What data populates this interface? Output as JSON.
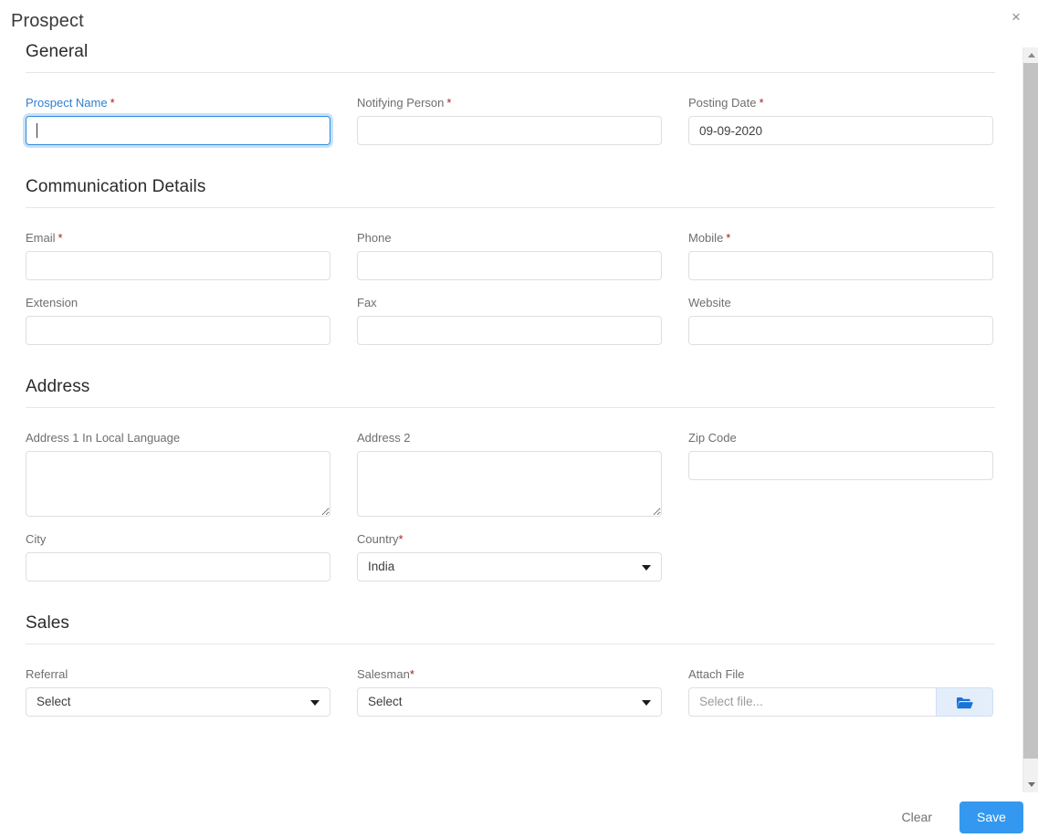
{
  "modal": {
    "title": "Prospect",
    "close_icon": "close-icon",
    "close_label": "×"
  },
  "sections": [
    {
      "id": "general",
      "title": "General",
      "fields": [
        {
          "label": "Prospect Name",
          "required": true,
          "value": "",
          "placeholder": "",
          "type": "text",
          "focused": true
        },
        {
          "label": "Notifying Person",
          "required": true,
          "value": "",
          "placeholder": "",
          "type": "text",
          "focused": false
        },
        {
          "label": "Posting Date",
          "required": true,
          "value": "09-09-2020",
          "placeholder": "",
          "type": "text",
          "focused": false
        }
      ]
    },
    {
      "id": "communication-details",
      "title": "Communication Details",
      "fields": [
        {
          "label": "Email",
          "required": true,
          "value": "",
          "type": "text"
        },
        {
          "label": "Phone",
          "required": false,
          "value": "",
          "type": "text"
        },
        {
          "label": "Mobile",
          "required": true,
          "value": "",
          "type": "text"
        },
        {
          "label": "Extension",
          "required": false,
          "value": "",
          "type": "text"
        },
        {
          "label": "Fax",
          "required": false,
          "value": "",
          "type": "text"
        },
        {
          "label": "Website",
          "required": false,
          "value": "",
          "type": "text"
        }
      ]
    },
    {
      "id": "address",
      "title": "Address",
      "fields": [
        {
          "label": "Address 1 In Local Language",
          "required": false,
          "value": "",
          "type": "textarea"
        },
        {
          "label": "Address 2",
          "required": false,
          "value": "",
          "type": "textarea"
        },
        {
          "label": "Zip Code",
          "required": false,
          "value": "",
          "type": "text"
        },
        {
          "label": "City",
          "required": false,
          "value": "",
          "type": "text"
        },
        {
          "label": "Country",
          "required": true,
          "value": "India",
          "type": "select"
        }
      ]
    },
    {
      "id": "sales",
      "title": "Sales",
      "fields": [
        {
          "label": "Referral",
          "required": false,
          "value": "Select",
          "type": "select"
        },
        {
          "label": "Salesman",
          "required": true,
          "required_tight": true,
          "value": "Select",
          "type": "select"
        },
        {
          "label": "Attach File",
          "required": false,
          "value": "",
          "placeholder": "Select file...",
          "type": "file",
          "button_icon": "folder-open-icon"
        }
      ]
    }
  ],
  "footer": {
    "clear_label": "Clear",
    "save_label": "Save"
  },
  "scrollbar": {
    "up_icon": "scroll-up-arrow-icon",
    "down_icon": "scroll-down-arrow-icon"
  },
  "colors": {
    "accent": "#3498f0",
    "focus_border": "#2c8ce0",
    "required_asterisk": "#9e1b1b",
    "focused_label": "#2f7fd1",
    "label": "#6e6e6e",
    "file_button_bg": "#e4eefb"
  }
}
